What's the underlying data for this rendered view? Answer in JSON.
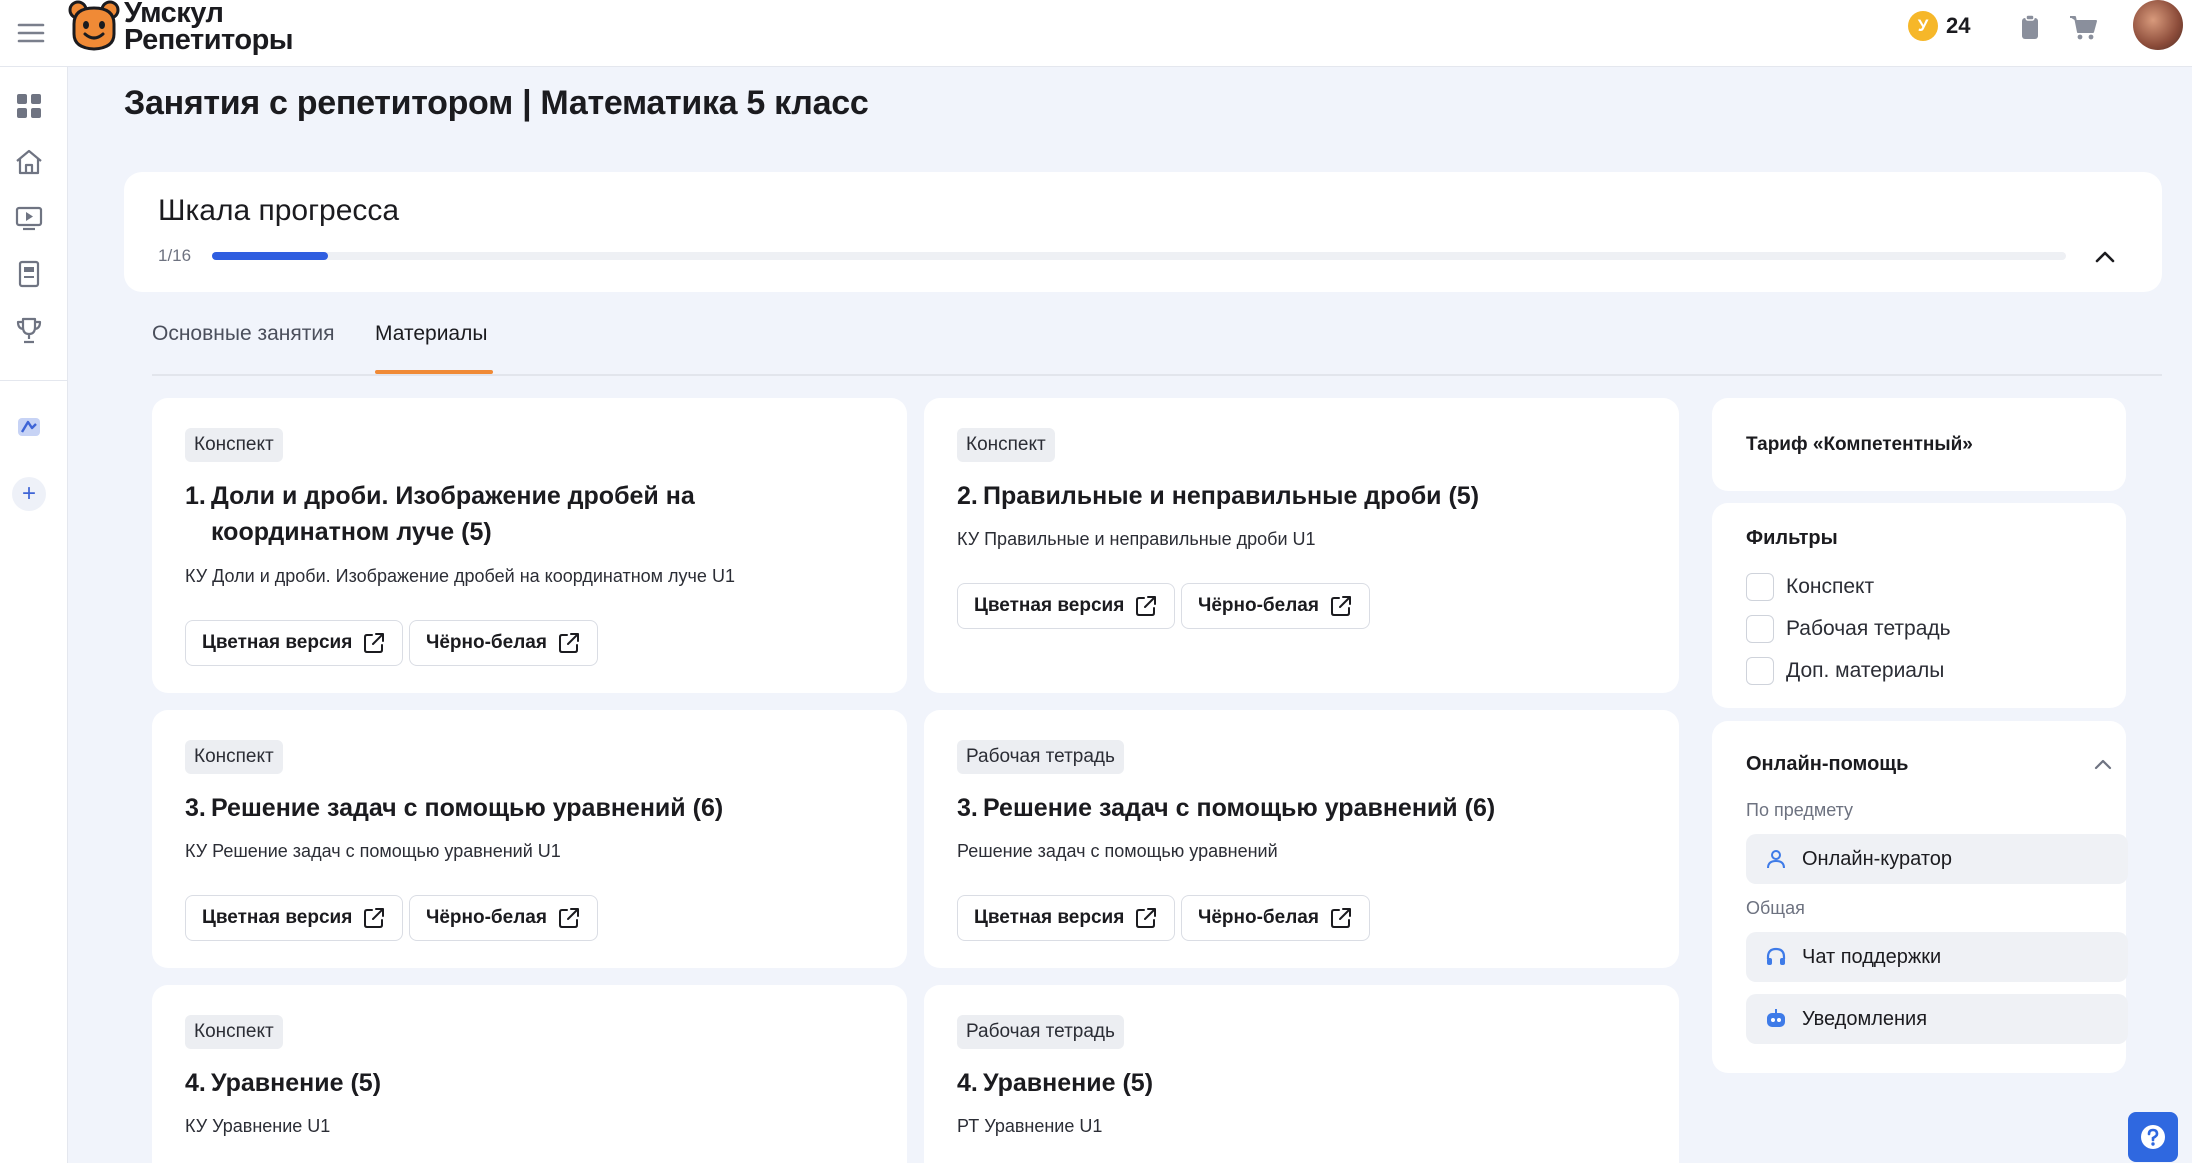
{
  "header": {
    "logo_line1": "Умскул",
    "logo_line2": "Репетиторы",
    "coin_symbol": "У",
    "coins": "24"
  },
  "page": {
    "title": "Занятия с репетитором | Математика 5 класс"
  },
  "progress": {
    "title": "Шкала прогресса",
    "count": "1/16",
    "fraction": 0.0625
  },
  "tabs": [
    {
      "label": "Основные занятия",
      "active": false
    },
    {
      "label": "Материалы",
      "active": true
    }
  ],
  "buttons": {
    "color": "Цветная версия",
    "bw": "Чёрно-белая"
  },
  "cards": [
    {
      "badge": "Конспект",
      "num": "1.",
      "title": "Доли и дроби. Изображение дробей на координатном луче (5)",
      "subtitle": "КУ Доли и дроби. Изображение дробей на координатном луче U1"
    },
    {
      "badge": "Конспект",
      "num": "2.",
      "title": "Правильные и неправильные дроби (5)",
      "subtitle": "КУ Правильные и неправильные дроби U1"
    },
    {
      "badge": "Конспект",
      "num": "3.",
      "title": "Решение задач с помощью уравнений (6)",
      "subtitle": "КУ Решение задач с помощью уравнений U1"
    },
    {
      "badge": "Рабочая тетрадь",
      "num": "3.",
      "title": "Решение задач с помощью уравнений (6)",
      "subtitle": "Решение задач с помощью уравнений"
    },
    {
      "badge": "Конспект",
      "num": "4.",
      "title": "Уравнение (5)",
      "subtitle": "КУ Уравнение U1"
    },
    {
      "badge": "Рабочая тетрадь",
      "num": "4.",
      "title": "Уравнение (5)",
      "subtitle": "РТ Уравнение U1"
    }
  ],
  "sidebar_right": {
    "tariff": "Тариф «Компетентный»",
    "filters_title": "Фильтры",
    "filters": [
      "Конспект",
      "Рабочая тетрадь",
      "Доп. материалы"
    ],
    "help_title": "Онлайн-помощь",
    "help_subject_label": "По предмету",
    "help_curator": "Онлайн-куратор",
    "help_general_label": "Общая",
    "help_chat": "Чат поддержки",
    "help_notifications": "Уведомления"
  },
  "colors": {
    "accent": "#2f5ee0",
    "tab_underline": "#f08a36",
    "coin": "#f6b729",
    "background": "#f1f4fb"
  }
}
